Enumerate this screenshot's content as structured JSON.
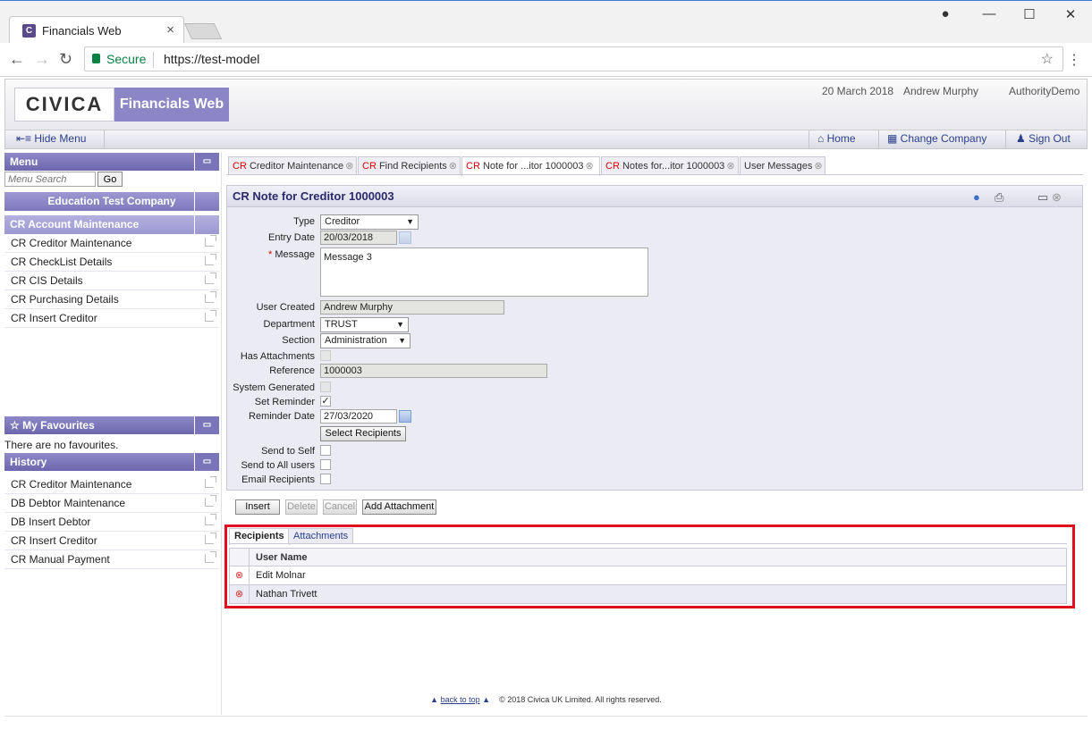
{
  "browser": {
    "tab_title": "Financials Web",
    "tab_favicon": "C",
    "secure_label": "Secure",
    "url": "https://test-model"
  },
  "header": {
    "logo": "CIVICA",
    "product": "Financials Web",
    "date": "20 March 2018",
    "user": "Andrew Murphy",
    "authority": "AuthorityDemo"
  },
  "menubar": {
    "hide_menu": "Hide Menu",
    "home": "Home",
    "change_company": "Change Company",
    "sign_out": "Sign Out"
  },
  "sidebar": {
    "menu_title": "Menu",
    "search_placeholder": "Menu Search",
    "go_label": "Go",
    "company": "Education Test Company",
    "section": "CR Account Maintenance",
    "items": [
      {
        "label": "CR Creditor Maintenance"
      },
      {
        "label": "CR CheckList Details"
      },
      {
        "label": "CR CIS Details"
      },
      {
        "label": "CR Purchasing Details"
      },
      {
        "label": "CR Insert Creditor"
      }
    ],
    "favourites_title": "My Favourites",
    "favourites_empty": "There are no favourites.",
    "history_title": "History",
    "history": [
      {
        "label": "CR Creditor Maintenance"
      },
      {
        "label": "DB Debtor Maintenance"
      },
      {
        "label": "DB Insert Debtor"
      },
      {
        "label": "CR Insert Creditor"
      },
      {
        "label": "CR Manual Payment"
      }
    ]
  },
  "tabs": [
    {
      "prefix": "CR",
      "label": "Creditor Maintenance"
    },
    {
      "prefix": "CR",
      "label": "Find Recipients"
    },
    {
      "prefix": "CR",
      "label": "Note for ...itor 1000003"
    },
    {
      "prefix": "CR",
      "label": "Notes for...itor 1000003"
    },
    {
      "prefix": "",
      "label": "User Messages"
    }
  ],
  "form": {
    "title": "CR Note for Creditor 1000003",
    "type_label": "Type",
    "type_value": "Creditor",
    "entry_date_label": "Entry Date",
    "entry_date_value": "20/03/2018",
    "required_mark": "*",
    "message_label": "Message",
    "message_value": "Message 3",
    "user_created_label": "User Created",
    "user_created_value": "Andrew Murphy",
    "department_label": "Department",
    "department_value": "TRUST",
    "section_label": "Section",
    "section_value": "Administration",
    "has_attachments_label": "Has Attachments",
    "reference_label": "Reference",
    "reference_value": "1000003",
    "system_generated_label": "System Generated",
    "set_reminder_label": "Set Reminder",
    "reminder_date_label": "Reminder Date",
    "reminder_date_value": "27/03/2020",
    "select_recipients": "Select Recipients",
    "send_to_self_label": "Send to Self",
    "send_to_all_label": "Send to All users",
    "email_recipients_label": "Email Recipients"
  },
  "actions": {
    "insert": "Insert",
    "delete": "Delete",
    "cancel": "Cancel",
    "add_attachment": "Add Attachment"
  },
  "recipients": {
    "tab_recipients": "Recipients",
    "tab_attachments": "Attachments",
    "column_user_name": "User Name",
    "rows": [
      {
        "name": "Edit Molnar"
      },
      {
        "name": "Nathan Trivett"
      }
    ]
  },
  "footer": {
    "back_to_top": "back to top",
    "copyright": "© 2018 Civica UK Limited. All rights reserved."
  }
}
